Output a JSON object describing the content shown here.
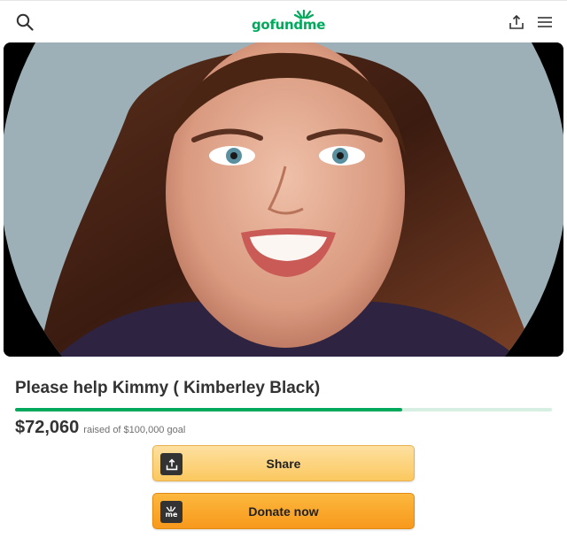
{
  "header": {
    "logo_text": "gofundme",
    "search_icon": "search-icon",
    "share_icon": "share-icon",
    "menu_icon": "hamburger-menu-icon",
    "brand_color": "#02a95c"
  },
  "campaign": {
    "title": "Please help Kimmy ( Kimberley Black)",
    "amount_raised": "$72,060",
    "goal_text": "raised of $100,000 goal",
    "progress_fraction": 0.7206
  },
  "actions": {
    "share_label": "Share",
    "donate_label": "Donate now",
    "donate_icon_text": "me"
  }
}
